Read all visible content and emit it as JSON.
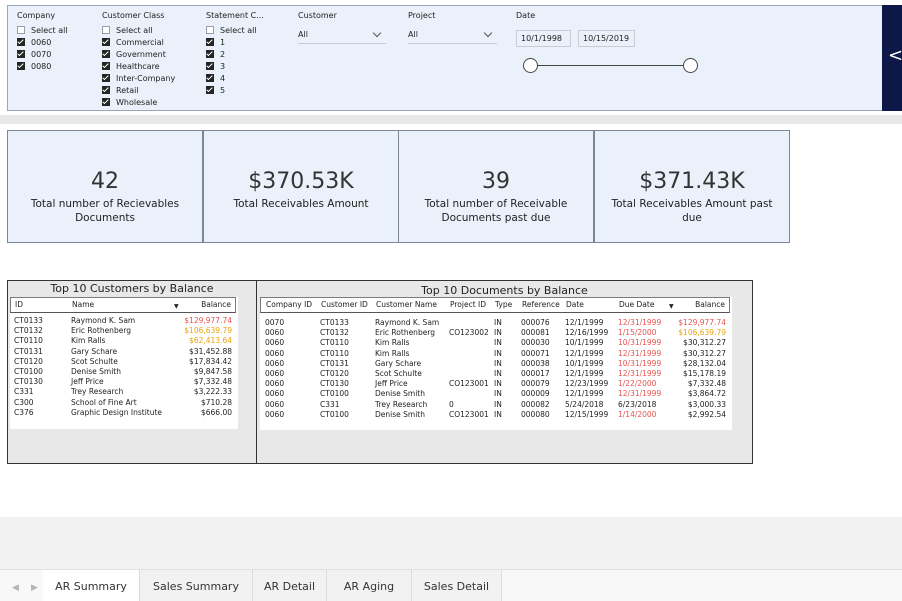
{
  "filters": {
    "company": {
      "title": "Company",
      "items": [
        {
          "label": "Select all",
          "checked": false
        },
        {
          "label": "0060",
          "checked": true
        },
        {
          "label": "0070",
          "checked": true
        },
        {
          "label": "0080",
          "checked": true
        }
      ]
    },
    "customer_class": {
      "title": "Customer Class",
      "items": [
        {
          "label": "Select all",
          "checked": false
        },
        {
          "label": "Commercial",
          "checked": true
        },
        {
          "label": "Government",
          "checked": true
        },
        {
          "label": "Healthcare",
          "checked": true
        },
        {
          "label": "Inter-Company",
          "checked": true
        },
        {
          "label": "Retail",
          "checked": true
        },
        {
          "label": "Wholesale",
          "checked": true
        }
      ]
    },
    "statement": {
      "title": "Statement C...",
      "items": [
        {
          "label": "Select all",
          "checked": false
        },
        {
          "label": "1",
          "checked": true
        },
        {
          "label": "2",
          "checked": true
        },
        {
          "label": "3",
          "checked": true
        },
        {
          "label": "4",
          "checked": true
        },
        {
          "label": "5",
          "checked": true
        }
      ]
    },
    "customer": {
      "title": "Customer",
      "value": "All"
    },
    "project": {
      "title": "Project",
      "value": "All"
    },
    "date": {
      "title": "Date",
      "start": "10/1/1998",
      "end": "10/15/2019"
    },
    "collapse_glyph": "<"
  },
  "kpis": [
    {
      "value": "42",
      "label": "Total number of Recievables Documents"
    },
    {
      "value": "$370.53K",
      "label": "Total Receivables Amount"
    },
    {
      "value": "39",
      "label": "Total number of Receivable Documents past due"
    },
    {
      "value": "$371.43K",
      "label": "Total Receivables Amount past due"
    }
  ],
  "top_customers": {
    "title": "Top 10 Customers by Balance",
    "columns": [
      "ID",
      "Name",
      "Balance"
    ],
    "sort_glyph": "▼",
    "rows": [
      {
        "id": "CT0133",
        "name": "Raymond K. Sam",
        "balance": "$129,977.74",
        "tone": "red"
      },
      {
        "id": "CT0132",
        "name": "Eric Rothenberg",
        "balance": "$106,639.79",
        "tone": "orange"
      },
      {
        "id": "CT0110",
        "name": "Kim Ralls",
        "balance": "$62,413.64",
        "tone": "orange"
      },
      {
        "id": "CT0131",
        "name": "Gary Schare",
        "balance": "$31,452.88",
        "tone": ""
      },
      {
        "id": "CT0120",
        "name": "Scot Schulte",
        "balance": "$17,834.42",
        "tone": ""
      },
      {
        "id": "CT0100",
        "name": "Denise Smith",
        "balance": "$9,847.58",
        "tone": ""
      },
      {
        "id": "CT0130",
        "name": "Jeff Price",
        "balance": "$7,332.48",
        "tone": ""
      },
      {
        "id": "C331",
        "name": "Trey Research",
        "balance": "$3,222.33",
        "tone": ""
      },
      {
        "id": "C300",
        "name": "School of Fine Art",
        "balance": "$710.28",
        "tone": ""
      },
      {
        "id": "C376",
        "name": "Graphic Design Institute",
        "balance": "$666.00",
        "tone": ""
      }
    ]
  },
  "top_documents": {
    "title": "Top 10 Documents by Balance",
    "columns": [
      "Company ID",
      "Customer ID",
      "Customer Name",
      "Project ID",
      "Type",
      "Reference",
      "Date",
      "Due Date",
      "Balance"
    ],
    "sort_glyph": "▼",
    "rows": [
      {
        "company": "0070",
        "customer": "CT0133",
        "name": "Raymond K. Sam",
        "project": "",
        "type": "IN",
        "reference": "000076",
        "date": "12/1/1999",
        "due": "12/31/1999",
        "due_tone": "red",
        "balance": "$129,977.74",
        "tone": "red"
      },
      {
        "company": "0060",
        "customer": "CT0132",
        "name": "Eric Rothenberg",
        "project": "CO123002",
        "type": "IN",
        "reference": "000081",
        "date": "12/16/1999",
        "due": "1/15/2000",
        "due_tone": "red",
        "balance": "$106,639.79",
        "tone": "orange"
      },
      {
        "company": "0060",
        "customer": "CT0110",
        "name": "Kim Ralls",
        "project": "",
        "type": "IN",
        "reference": "000030",
        "date": "10/1/1999",
        "due": "10/31/1999",
        "due_tone": "red",
        "balance": "$30,312.27",
        "tone": ""
      },
      {
        "company": "0060",
        "customer": "CT0110",
        "name": "Kim Ralls",
        "project": "",
        "type": "IN",
        "reference": "000071",
        "date": "12/1/1999",
        "due": "12/31/1999",
        "due_tone": "red",
        "balance": "$30,312.27",
        "tone": ""
      },
      {
        "company": "0060",
        "customer": "CT0131",
        "name": "Gary Schare",
        "project": "",
        "type": "IN",
        "reference": "000038",
        "date": "10/1/1999",
        "due": "10/31/1999",
        "due_tone": "red",
        "balance": "$28,132.04",
        "tone": ""
      },
      {
        "company": "0060",
        "customer": "CT0120",
        "name": "Scot Schulte",
        "project": "",
        "type": "IN",
        "reference": "000017",
        "date": "12/1/1999",
        "due": "12/31/1999",
        "due_tone": "red",
        "balance": "$15,178.19",
        "tone": ""
      },
      {
        "company": "0060",
        "customer": "CT0130",
        "name": "Jeff Price",
        "project": "CO123001",
        "type": "IN",
        "reference": "000079",
        "date": "12/23/1999",
        "due": "1/22/2000",
        "due_tone": "red",
        "balance": "$7,332.48",
        "tone": ""
      },
      {
        "company": "0060",
        "customer": "CT0100",
        "name": "Denise Smith",
        "project": "",
        "type": "IN",
        "reference": "000009",
        "date": "12/1/1999",
        "due": "12/31/1999",
        "due_tone": "red",
        "balance": "$3,864.72",
        "tone": ""
      },
      {
        "company": "0060",
        "customer": "C331",
        "name": "Trey Research",
        "project": "0",
        "type": "IN",
        "reference": "000082",
        "date": "5/24/2018",
        "due": "6/23/2018",
        "due_tone": "",
        "balance": "$3,000.33",
        "tone": ""
      },
      {
        "company": "0060",
        "customer": "CT0100",
        "name": "Denise Smith",
        "project": "CO123001",
        "type": "IN",
        "reference": "000080",
        "date": "12/15/1999",
        "due": "1/14/2000",
        "due_tone": "red",
        "balance": "$2,992.54",
        "tone": ""
      }
    ]
  },
  "tabs": [
    {
      "label": "AR Summary",
      "active": true
    },
    {
      "label": "Sales Summary",
      "active": false
    },
    {
      "label": "AR Detail",
      "active": false
    },
    {
      "label": "AR Aging",
      "active": false
    },
    {
      "label": "Sales Detail",
      "active": false
    }
  ],
  "nav": {
    "prev": "◀",
    "next": "▶"
  },
  "colors": {
    "panel": "#eaf1fa",
    "navy": "#0d1848",
    "past_due_red": "#e8534f",
    "warn_orange": "#e8a40c"
  }
}
